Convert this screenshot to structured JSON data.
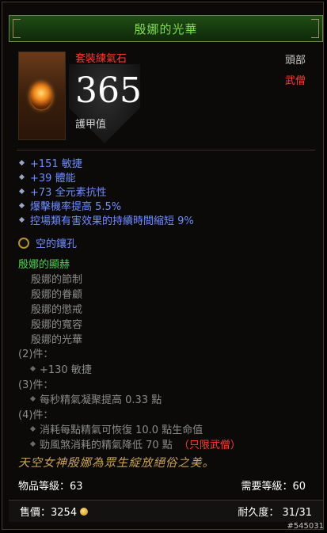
{
  "item": {
    "name": "殷娜的光華",
    "type": "套裝練氣石",
    "slot": "頭部",
    "class": "武僧",
    "armor_value": "365",
    "armor_label": "護甲值",
    "name_color": "#7fdc4f",
    "affix_color": "#6f8cff",
    "set_color": "#49d24a"
  },
  "affixes": [
    "+151 敏捷",
    "+39 體能",
    "+73 全元素抗性",
    "爆擊機率提高 5.5%",
    "控場類有害效果的持續時間縮短 9%"
  ],
  "socket": {
    "label": "空的鑲孔",
    "icon": "empty-socket-icon"
  },
  "set": {
    "name": "殷娜的顯赫",
    "items": [
      "殷娜的節制",
      "殷娜的眷顧",
      "殷娜的懲戒",
      "殷娜的寬容",
      "殷娜的光華"
    ],
    "bonus2_label": "(2)件：",
    "bonus2_lines": [
      "+130 敏捷"
    ],
    "bonus3_label": "(3)件：",
    "bonus3_lines": [
      "每秒精氣凝聚提高 0.33 點"
    ],
    "bonus4_label": "(4)件：",
    "bonus4_lines": [
      "消耗每點精氣可恢復 10.0 點生命值",
      "勁風煞消耗的精氣降低 70 點"
    ],
    "bonus4_class_only": "（只限武僧）"
  },
  "flavor_text": "天空女神殷娜為眾生綻放絕俗之美。",
  "item_level": "物品等級：63",
  "required_level": "需要等級：60",
  "footer": {
    "price": "售價：3254",
    "durability": "耐久度：  31/31"
  },
  "item_id": "#545031"
}
